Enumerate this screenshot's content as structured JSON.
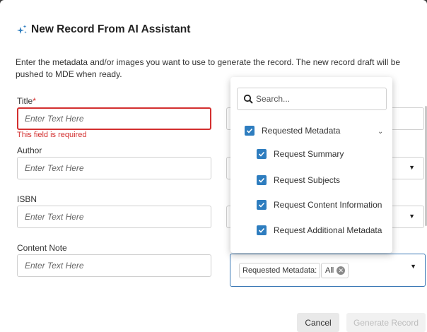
{
  "dialog": {
    "title": "New Record From AI Assistant",
    "description": "Enter the metadata and/or images you want to use to generate the record. The new record draft will be pushed to MDE when ready."
  },
  "form": {
    "title_label": "Title",
    "required_mark": "*",
    "title_placeholder": "Enter Text Here",
    "title_error": "This field is required",
    "author_label": "Author",
    "author_placeholder": "Enter Text Here",
    "isbn_label": "ISBN",
    "isbn_placeholder": "Enter Text Here",
    "content_note_label": "Content Note",
    "content_note_placeholder": "Enter Text Here"
  },
  "metadata_select": {
    "chip_label": "Requested Metadata:",
    "chip_value": "All",
    "search_placeholder": "Search...",
    "group_label": "Requested Metadata",
    "options": [
      {
        "label": "Request Summary",
        "checked": true
      },
      {
        "label": "Request Subjects",
        "checked": true
      },
      {
        "label": "Request Content Information",
        "checked": true
      },
      {
        "label": "Request Additional Metadata",
        "checked": true
      }
    ]
  },
  "footer": {
    "cancel_label": "Cancel",
    "generate_label": "Generate Record"
  },
  "colors": {
    "accent": "#2e7dbf",
    "error": "#d32f2f"
  }
}
